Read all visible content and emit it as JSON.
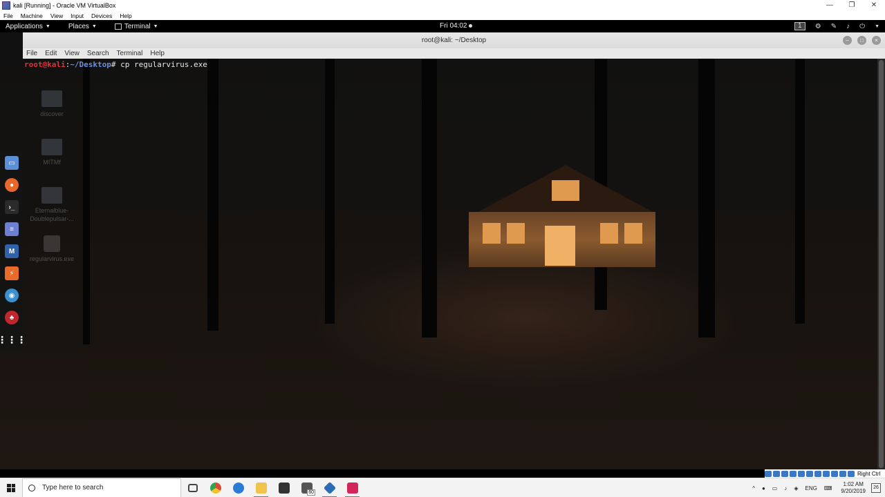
{
  "host_window": {
    "title": "kali [Running] - Oracle VM VirtualBox",
    "menu": [
      "File",
      "Machine",
      "View",
      "Input",
      "Devices",
      "Help"
    ],
    "controls": {
      "minimize": "—",
      "restore": "❐",
      "close": "✕"
    }
  },
  "gnome_top_bar": {
    "applications": "Applications",
    "places": "Places",
    "terminal_app": "Terminal",
    "clock": "Fri 04:02",
    "workspace": "1"
  },
  "terminal": {
    "title": "root@kali: ~/Desktop",
    "menu": [
      "File",
      "Edit",
      "View",
      "Search",
      "Terminal",
      "Help"
    ],
    "prompt_user": "root@kali",
    "prompt_sep": ":",
    "prompt_path": "~/Desktop",
    "prompt_symbol": "#",
    "command": " cp regularvirus.exe"
  },
  "desktop_icons": [
    {
      "label": "discover",
      "kind": "folder"
    },
    {
      "label": "MITMf",
      "kind": "folder"
    },
    {
      "label": "Eternalblue-Doublepulsar-...",
      "kind": "folder"
    },
    {
      "label": "regularvirus.exe",
      "kind": "file"
    }
  ],
  "dock": [
    {
      "icon": "files-icon",
      "color": "#5b8fd6"
    },
    {
      "icon": "firefox-icon",
      "color": "#e8682b"
    },
    {
      "icon": "terminal-icon",
      "color": "#2b2b2b"
    },
    {
      "icon": "text-editor-icon",
      "color": "#6d7fd1"
    },
    {
      "icon": "metasploit-icon",
      "color": "#2f62a8"
    },
    {
      "icon": "burpsuite-icon",
      "color": "#e96b2a"
    },
    {
      "icon": "eye-icon",
      "color": "#3a8fd0"
    },
    {
      "icon": "armitage-icon",
      "color": "#c0262d"
    },
    {
      "icon": "app-grid-icon",
      "color": "#333333"
    }
  ],
  "vbox_status": {
    "host_key": "Right Ctrl"
  },
  "taskbar": {
    "search_placeholder": "Type here to search",
    "apps": [
      {
        "icon": "task-view-icon",
        "color": "#444444"
      },
      {
        "icon": "chrome-icon",
        "color": "#d94a36"
      },
      {
        "icon": "edge-icon",
        "color": "#2a7bd6"
      },
      {
        "icon": "file-explorer-icon",
        "color": "#f2c34b"
      },
      {
        "icon": "store-icon",
        "color": "#333333"
      },
      {
        "icon": "mail-icon",
        "color": "#555555"
      },
      {
        "icon": "virtualbox-icon",
        "color": "#2c6bb5"
      },
      {
        "icon": "screen-recorder-icon",
        "color": "#d4255a"
      }
    ],
    "mail_badge": "60",
    "tray": {
      "language": "ENG",
      "time": "1:02 AM",
      "date": "9/20/2019",
      "notification_count": "26"
    }
  }
}
